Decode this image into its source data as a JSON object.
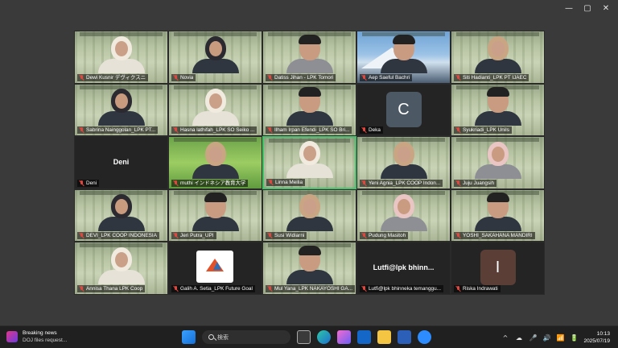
{
  "window_controls": {
    "minimize": "—",
    "maximize": "▢",
    "close": "✕"
  },
  "participants": [
    {
      "name": "Dewi Kusnir デヴィクスニ",
      "kind": "video",
      "look": "hijab"
    },
    {
      "name": "Novia",
      "kind": "video",
      "look": "hijab-dark"
    },
    {
      "name": "Datiss Jihan - LPK Tomori",
      "kind": "video",
      "look": "none"
    },
    {
      "name": "Aep Saeful Bachri",
      "kind": "video",
      "look": "fuji"
    },
    {
      "name": "Siti Hadianti_LPK PT IJAEC",
      "kind": "video",
      "look": "hijab-tan"
    },
    {
      "name": "Sabrina Nainggolan_LPK PT...",
      "kind": "video",
      "look": "hijab-dark"
    },
    {
      "name": "Hasna lathifah_LPK SO Seiko ...",
      "kind": "video",
      "look": "hijab"
    },
    {
      "name": "Ilham Irpan Efendi_LPK SO Bri...",
      "kind": "video",
      "look": "man"
    },
    {
      "name": "Deka",
      "kind": "avatar",
      "letter": "C"
    },
    {
      "name": "Syukriadi_LPK Unils",
      "kind": "video",
      "look": "man"
    },
    {
      "name": "Deni",
      "kind": "blank",
      "label": "Deni"
    },
    {
      "name": "muthi インドネシア教育大学",
      "kind": "video",
      "look": "zoom"
    },
    {
      "name": "Linna Meilia",
      "kind": "video",
      "look": "hijab",
      "active": true
    },
    {
      "name": "Yeni Agnia_LPK COOP Indon...",
      "kind": "video",
      "look": "hijab-tan"
    },
    {
      "name": "Juju Juangsih",
      "kind": "video",
      "look": "hijab-pink"
    },
    {
      "name": "DEVI_LPK COOP INDONESIA",
      "kind": "video",
      "look": "hijab-dark"
    },
    {
      "name": "Jeri Putra_UPI",
      "kind": "video",
      "look": "man"
    },
    {
      "name": "Susi Widiarni",
      "kind": "video",
      "look": "hijab-tan"
    },
    {
      "name": "Pudung Masitoh",
      "kind": "video",
      "look": "hijab-pink"
    },
    {
      "name": "YOSHI_SAKAHANA MANDIRI",
      "kind": "video",
      "look": "man"
    },
    {
      "name": "Annisa Thana LPK Coop",
      "kind": "video",
      "look": "hijab"
    },
    {
      "name": "Galih A. Setia_LPK Future Goal",
      "kind": "logo"
    },
    {
      "name": "Mul Yana_LPK NAKAYOSHI GA...",
      "kind": "video",
      "look": "man"
    },
    {
      "name": "Lutfi@lpk bhinneka temanggu...",
      "kind": "blank",
      "label": "Lutfi@lpk bhinn..."
    },
    {
      "name": "Riska Indrawati",
      "kind": "avatar",
      "letter": "I",
      "brown": true
    }
  ],
  "taskbar": {
    "news_title": "Breaking news",
    "news_sub": "DOJ files request...",
    "search_placeholder": "検索",
    "time": "10:13",
    "date": "2025/07/19",
    "tray": [
      "^",
      "☁",
      "🎤",
      "🔊",
      "📶",
      "🔋"
    ]
  },
  "colors": {
    "active_speaker": "#45c36a",
    "muted": "#e0473e",
    "background": "#3a3a3a"
  }
}
